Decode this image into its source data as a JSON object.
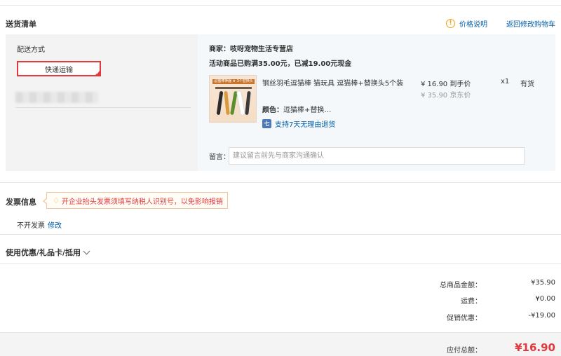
{
  "delivery": {
    "section_title": "送货清单",
    "price_explain_icon": "info-icon",
    "price_explain": "价格说明",
    "back_to_cart": "返回修改购物车",
    "shipping_label": "配送方式",
    "shipping_option": "快递运输"
  },
  "order": {
    "seller": "商家：吱呀宠物生活专营店",
    "promo": "活动商品已购满35.00元，已减19.00元现金",
    "thumb_banner": "逗猫棒神器 ★ 3个替换头",
    "product_title": "钢丝羽毛逗猫棒 猫玩具 逗猫棒+替换头5个装",
    "price": "¥ 16.90 到手价",
    "old_price": "¥ 35.90 京东价",
    "qty": "x1",
    "stock": "有货",
    "color_label": "颜色：",
    "color_value": "逗猫棒+替换…",
    "return_icon": "seven-day-return-icon",
    "return_text": "支持7天无理由退货",
    "message_label": "留言：",
    "message_placeholder": "建议留言前先与商家沟通确认"
  },
  "invoice": {
    "title": "发票信息",
    "tip_icon": "lightbulb-icon",
    "tip": "开企业抬头发票须填写纳税人识别号，以免影响报销",
    "status": "不开发票",
    "edit": "修改"
  },
  "coupon": {
    "title": "使用优惠/礼品卡/抵用"
  },
  "summary": {
    "goods_label": "总商品金额：",
    "goods_value": "¥35.90",
    "shipping_label": "运费：",
    "shipping_value": "¥0.00",
    "discount_label": "促销优惠：",
    "discount_value": "-¥19.00",
    "total_label": "应付总额：",
    "total_value": "¥16.90"
  },
  "colors": {
    "accent": "#e4393c",
    "link": "#005ea7"
  }
}
